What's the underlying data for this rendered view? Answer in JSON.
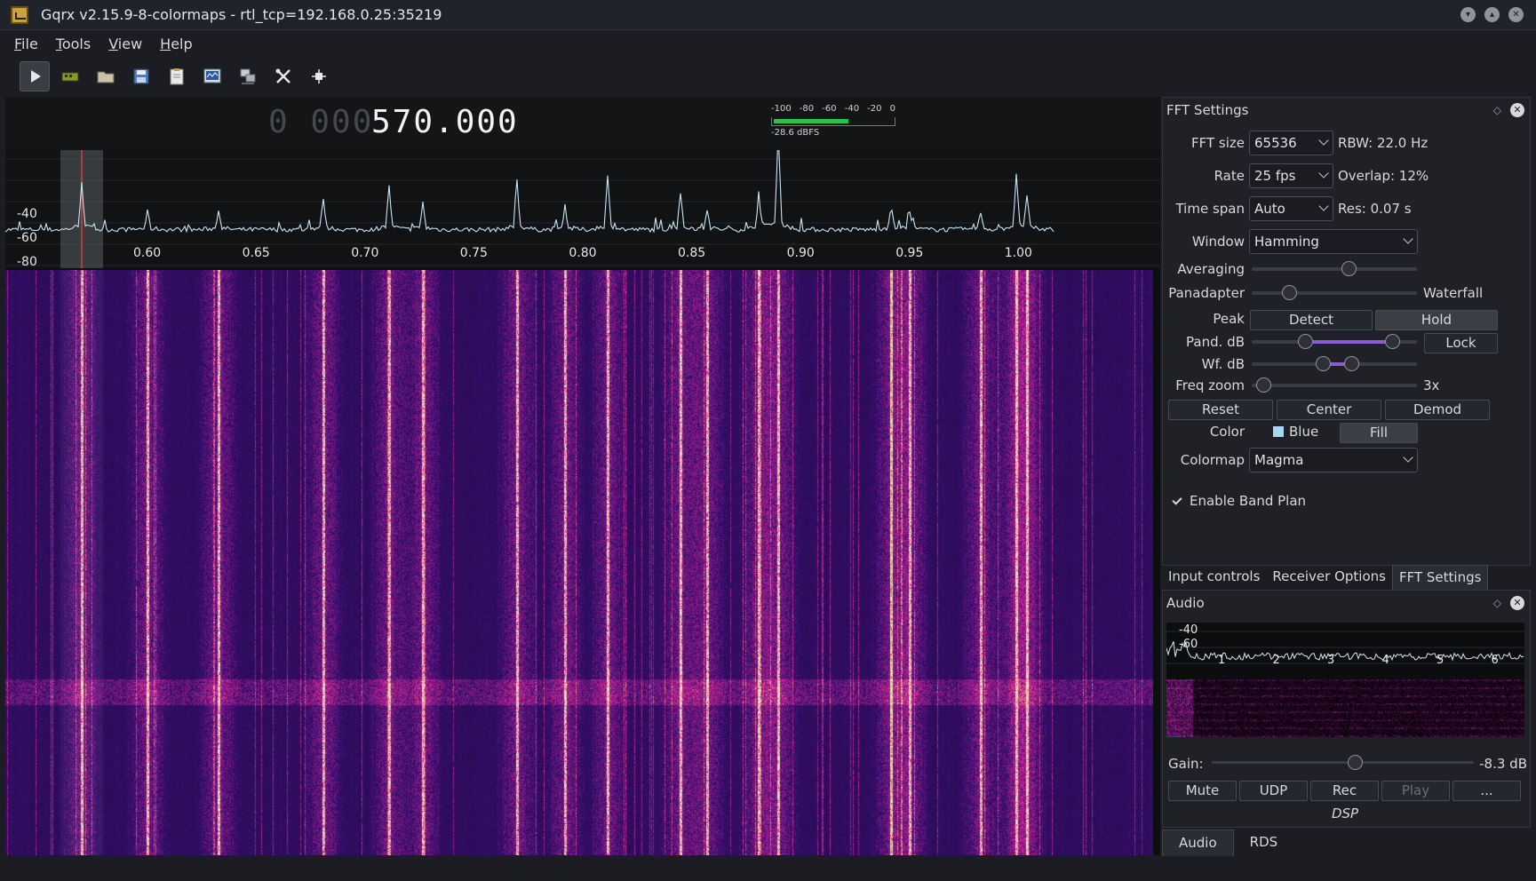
{
  "window": {
    "title": "Gqrx v2.15.9-8-colormaps - rtl_tcp=192.168.0.25:35219",
    "controls": [
      "minimize",
      "maximize",
      "close"
    ]
  },
  "menu": [
    {
      "u": "F",
      "rest": "ile"
    },
    {
      "u": "T",
      "rest": "ools"
    },
    {
      "u": "V",
      "rest": "iew"
    },
    {
      "u": "H",
      "rest": "elp"
    }
  ],
  "toolbar": {
    "icons": [
      "play-icon",
      "device-icon",
      "folder-open-icon",
      "save-icon",
      "clipboard-icon",
      "remote-control-icon",
      "network-icon",
      "tools-icon",
      "settings-icon"
    ]
  },
  "frequency": {
    "dim": "0 000",
    "bright": "570.000"
  },
  "meter": {
    "scale": [
      "-100",
      "-80",
      "-60",
      "-40",
      "-20",
      "0"
    ],
    "label": "-28.6 dBFS",
    "level_dbfs": -28.6
  },
  "pandapter": {
    "y_labels": [
      "-40",
      "-60",
      "-80"
    ],
    "x_labels": [
      "0.60",
      "0.65",
      "0.70",
      "0.75",
      "0.80",
      "0.85",
      "0.90",
      "0.95",
      "1.00"
    ]
  },
  "fft": {
    "title": "FFT Settings",
    "fft_size_label": "FFT size",
    "fft_size": "65536",
    "rbw": "RBW: 22.0 Hz",
    "rate_label": "Rate",
    "rate": "25 fps",
    "overlap": "Overlap: 12%",
    "timespan_label": "Time span",
    "timespan": "Auto",
    "res": "Res: 0.07 s",
    "window_label": "Window",
    "window": "Hamming",
    "averaging_label": "Averaging",
    "panadapter_label": "Panadapter",
    "waterfall_label": "Waterfall",
    "peak_label": "Peak",
    "detect": "Detect",
    "hold": "Hold",
    "pand_db_label": "Pand. dB",
    "lock": "Lock",
    "wf_db_label": "Wf. dB",
    "freqzoom_label": "Freq zoom",
    "freqzoom": "3x",
    "reset": "Reset",
    "center": "Center",
    "demod": "Demod",
    "color_label": "Color",
    "color": "Blue",
    "fill": "Fill",
    "colormap_label": "Colormap",
    "colormap": "Magma",
    "bandplan": "Enable Band Plan",
    "averaging_level": 0.6,
    "panadapter_split": 0.2,
    "freqzoom_level": 0.03
  },
  "dock_tabs": [
    "Input controls",
    "Receiver Options",
    "FFT Settings"
  ],
  "audio": {
    "title": "Audio",
    "y_labels": [
      "-40",
      "-60"
    ],
    "x_labels": [
      "1",
      "2",
      "3",
      "4",
      "5",
      "6"
    ],
    "gain_label": "Gain:",
    "gain": "-8.3 dB",
    "gain_level": 0.55,
    "mute": "Mute",
    "udp": "UDP",
    "rec": "Rec",
    "play": "Play",
    "more": "...",
    "dsp": "DSP"
  },
  "bottom_tabs": [
    "Audio",
    "RDS"
  ]
}
